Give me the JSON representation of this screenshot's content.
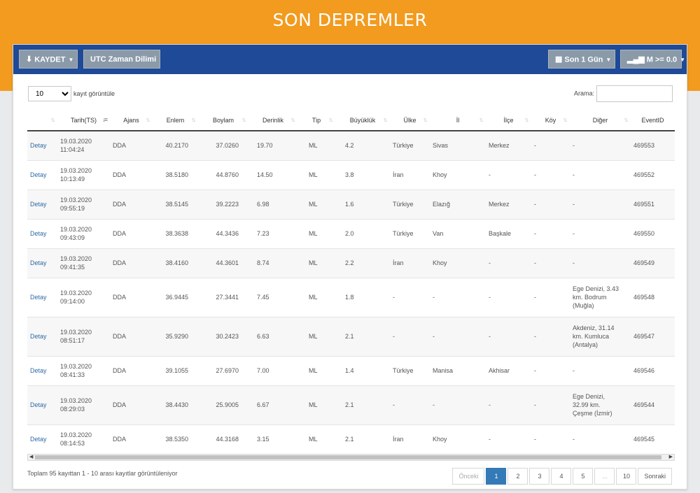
{
  "header": {
    "title": "SON DEPREMLER"
  },
  "toolbar": {
    "save_label": "KAYDET",
    "utc_label": "UTC Zaman Dilimi",
    "period_label": "Son 1 Gün",
    "magnitude_label": "M >= 0.0"
  },
  "controls": {
    "length_value": "10",
    "length_label": "kayıt görüntüle",
    "search_label": "Arama:",
    "search_value": ""
  },
  "table": {
    "columns": [
      "",
      "Tarih(TS)",
      "Ajans",
      "Enlem",
      "Boylam",
      "Derinlik",
      "Tip",
      "Büyüklük",
      "Ülke",
      "İl",
      "İlçe",
      "Köy",
      "Diğer",
      "EventID"
    ],
    "rows": [
      {
        "link": "Detay",
        "date": "19.03.2020",
        "time": "11:04:24",
        "agency": "DDA",
        "lat": "40.2170",
        "lon": "37.0260",
        "depth": "19.70",
        "type": "ML",
        "mag": "4.2",
        "country": "Türkiye",
        "province": "Sivas",
        "district": "Merkez",
        "village": "-",
        "other": [
          "-"
        ],
        "event_id": "469553"
      },
      {
        "link": "Detay",
        "date": "19.03.2020",
        "time": "10:13:49",
        "agency": "DDA",
        "lat": "38.5180",
        "lon": "44.8760",
        "depth": "14.50",
        "type": "ML",
        "mag": "3.8",
        "country": "İran",
        "province": "Khoy",
        "district": "-",
        "village": "-",
        "other": [
          "-"
        ],
        "event_id": "469552"
      },
      {
        "link": "Detay",
        "date": "19.03.2020",
        "time": "09:55:19",
        "agency": "DDA",
        "lat": "38.5145",
        "lon": "39.2223",
        "depth": "6.98",
        "type": "ML",
        "mag": "1.6",
        "country": "Türkiye",
        "province": "Elazığ",
        "district": "Merkez",
        "village": "-",
        "other": [
          "-"
        ],
        "event_id": "469551"
      },
      {
        "link": "Detay",
        "date": "19.03.2020",
        "time": "09:43:09",
        "agency": "DDA",
        "lat": "38.3638",
        "lon": "44.3436",
        "depth": "7.23",
        "type": "ML",
        "mag": "2.0",
        "country": "Türkiye",
        "province": "Van",
        "district": "Başkale",
        "village": "-",
        "other": [
          "-"
        ],
        "event_id": "469550"
      },
      {
        "link": "Detay",
        "date": "19.03.2020",
        "time": "09:41:35",
        "agency": "DDA",
        "lat": "38.4160",
        "lon": "44.3601",
        "depth": "8.74",
        "type": "ML",
        "mag": "2.2",
        "country": "İran",
        "province": "Khoy",
        "district": "-",
        "village": "-",
        "other": [
          "-"
        ],
        "event_id": "469549"
      },
      {
        "link": "Detay",
        "date": "19.03.2020",
        "time": "09:14:00",
        "agency": "DDA",
        "lat": "36.9445",
        "lon": "27.3441",
        "depth": "7.45",
        "type": "ML",
        "mag": "1.8",
        "country": "-",
        "province": "-",
        "district": "-",
        "village": "-",
        "other": [
          "Ege Denizi, 3.43",
          "km. Bodrum",
          "(Muğla)"
        ],
        "event_id": "469548"
      },
      {
        "link": "Detay",
        "date": "19.03.2020",
        "time": "08:51:17",
        "agency": "DDA",
        "lat": "35.9290",
        "lon": "30.2423",
        "depth": "6.63",
        "type": "ML",
        "mag": "2.1",
        "country": "-",
        "province": "-",
        "district": "-",
        "village": "-",
        "other": [
          "Akdeniz, 31.14",
          "km. Kumluca",
          "(Antalya)"
        ],
        "event_id": "469547"
      },
      {
        "link": "Detay",
        "date": "19.03.2020",
        "time": "08:41:33",
        "agency": "DDA",
        "lat": "39.1055",
        "lon": "27.6970",
        "depth": "7.00",
        "type": "ML",
        "mag": "1.4",
        "country": "Türkiye",
        "province": "Manisa",
        "district": "Akhisar",
        "village": "-",
        "other": [
          "-"
        ],
        "event_id": "469546"
      },
      {
        "link": "Detay",
        "date": "19.03.2020",
        "time": "08:29:03",
        "agency": "DDA",
        "lat": "38.4430",
        "lon": "25.9005",
        "depth": "6.67",
        "type": "ML",
        "mag": "2.1",
        "country": "-",
        "province": "-",
        "district": "-",
        "village": "-",
        "other": [
          "Ege Denizi,",
          "32.99 km.",
          "Çeşme (İzmir)"
        ],
        "event_id": "469544"
      },
      {
        "link": "Detay",
        "date": "19.03.2020",
        "time": "08:14:53",
        "agency": "DDA",
        "lat": "38.5350",
        "lon": "44.3168",
        "depth": "3.15",
        "type": "ML",
        "mag": "2.1",
        "country": "İran",
        "province": "Khoy",
        "district": "-",
        "village": "-",
        "other": [
          "-"
        ],
        "event_id": "469545"
      }
    ]
  },
  "footer": {
    "info": "Toplam 95 kayıttan 1 - 10 arası kayıtlar görüntüleniyor",
    "prev_label": "Önceki",
    "pages": [
      "1",
      "2",
      "3",
      "4",
      "5",
      "...",
      "10"
    ],
    "next_label": "Sonraki",
    "current_page": "1"
  }
}
